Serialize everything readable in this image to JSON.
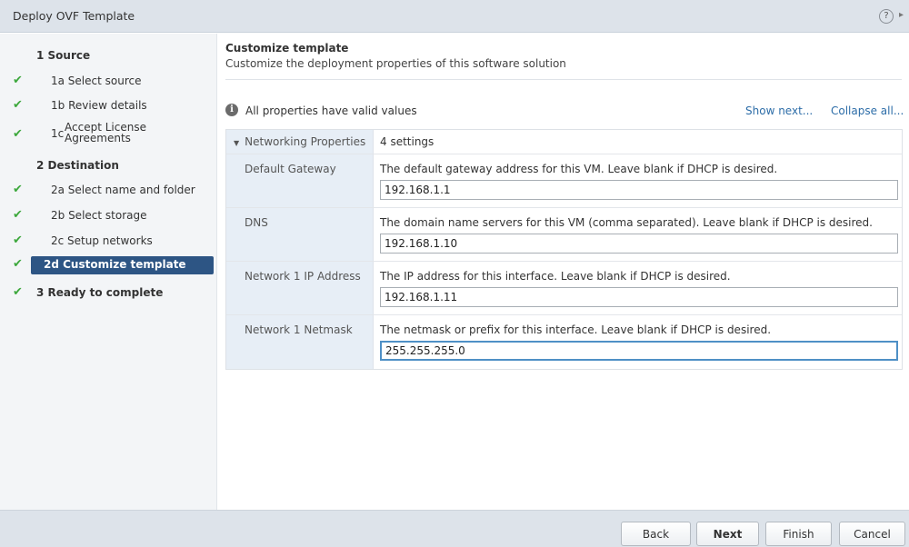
{
  "window": {
    "title": "Deploy OVF Template",
    "help_glyph": "?",
    "arrow_glyph": "▸"
  },
  "steps": [
    {
      "id": "1",
      "label": "1  Source",
      "header": true,
      "checked": false
    },
    {
      "id": "1a",
      "label": "1a  Select source",
      "checked": true
    },
    {
      "id": "1b",
      "label": "1b  Review details",
      "checked": true
    },
    {
      "id": "1c",
      "prefix": "1c",
      "line1": "Accept License",
      "line2": "Agreements",
      "checked": true
    },
    {
      "id": "2",
      "label": "2  Destination",
      "header": true,
      "checked": false
    },
    {
      "id": "2a",
      "label": "2a  Select name and folder",
      "checked": true
    },
    {
      "id": "2b",
      "label": "2b  Select storage",
      "checked": true
    },
    {
      "id": "2c",
      "label": "2c  Setup networks",
      "checked": true
    },
    {
      "id": "2d",
      "label": "2d  Customize template",
      "checked": true,
      "active": true
    },
    {
      "id": "3",
      "label": "3  Ready to complete",
      "header": true,
      "checked": true
    }
  ],
  "main": {
    "title": "Customize template",
    "description": "Customize the deployment properties of this software solution",
    "info_text": "All properties have valid values",
    "show_next": "Show next...",
    "collapse_all": "Collapse all..."
  },
  "properties": {
    "group_name": "Networking Properties",
    "group_count": "4 settings",
    "fields": [
      {
        "name": "Default Gateway",
        "desc": "The default gateway address for this VM. Leave blank if DHCP is desired.",
        "value": "192.168.1.1"
      },
      {
        "name": "DNS",
        "desc": "The domain name servers for this VM (comma separated). Leave blank if DHCP is desired.",
        "value": "192.168.1.10"
      },
      {
        "name": "Network 1 IP Address",
        "desc": "The IP address for this interface. Leave blank if DHCP is desired.",
        "value": "192.168.1.11"
      },
      {
        "name": "Network 1 Netmask",
        "desc": "The netmask or prefix for this interface. Leave blank if DHCP is desired.",
        "value": "255.255.255.0"
      }
    ]
  },
  "footer": {
    "back": "Back",
    "next": "Next",
    "finish": "Finish",
    "cancel": "Cancel"
  },
  "colors": {
    "accent": "#2d5584",
    "check": "#3da83d",
    "link": "#2d6da8",
    "focus": "#4f90c6"
  }
}
